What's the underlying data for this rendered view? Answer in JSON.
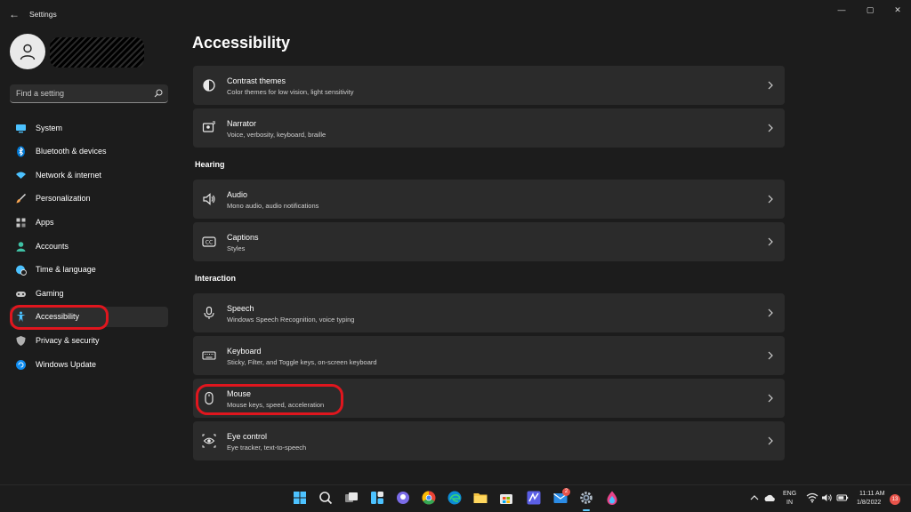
{
  "window": {
    "title": "Settings",
    "back_glyph": "←",
    "controls": {
      "minimize": "—",
      "maximize": "▢",
      "close": "✕"
    }
  },
  "search": {
    "placeholder": "Find a setting",
    "icon": "search-icon"
  },
  "sidebar": {
    "items": [
      {
        "label": "System",
        "icon": "monitor-icon",
        "color": "#4cc2ff"
      },
      {
        "label": "Bluetooth & devices",
        "icon": "bluetooth-icon",
        "color": "#0078d4"
      },
      {
        "label": "Network & internet",
        "icon": "wifi-icon",
        "color": "#4cc2ff"
      },
      {
        "label": "Personalization",
        "icon": "brush-icon",
        "color": "#f7a552"
      },
      {
        "label": "Apps",
        "icon": "apps-icon",
        "color": "#c6c6c6"
      },
      {
        "label": "Accounts",
        "icon": "person-icon",
        "color": "#3fc1a5"
      },
      {
        "label": "Time & language",
        "icon": "globe-clock-icon",
        "color": "#4cc2ff"
      },
      {
        "label": "Gaming",
        "icon": "gamepad-icon",
        "color": "#c6c6c6"
      },
      {
        "label": "Accessibility",
        "icon": "accessibility-icon",
        "color": "#4cc2ff",
        "active": true
      },
      {
        "label": "Privacy & security",
        "icon": "shield-icon",
        "color": "#b0b0b0"
      },
      {
        "label": "Windows Update",
        "icon": "update-icon",
        "color": "#0f8cf0"
      }
    ]
  },
  "main": {
    "title": "Accessibility",
    "groups": [
      {
        "heading": "",
        "cards": [
          {
            "title": "Contrast themes",
            "subtitle": "Color themes for low vision, light sensitivity",
            "icon": "contrast-icon"
          },
          {
            "title": "Narrator",
            "subtitle": "Voice, verbosity, keyboard, braille",
            "icon": "narrator-icon"
          }
        ]
      },
      {
        "heading": "Hearing",
        "cards": [
          {
            "title": "Audio",
            "subtitle": "Mono audio, audio notifications",
            "icon": "speaker-icon"
          },
          {
            "title": "Captions",
            "subtitle": "Styles",
            "icon": "captions-icon"
          }
        ]
      },
      {
        "heading": "Interaction",
        "cards": [
          {
            "title": "Speech",
            "subtitle": "Windows Speech Recognition, voice typing",
            "icon": "microphone-icon"
          },
          {
            "title": "Keyboard",
            "subtitle": "Sticky, Filter, and Toggle keys, on-screen keyboard",
            "icon": "keyboard-icon"
          },
          {
            "title": "Mouse",
            "subtitle": "Mouse keys, speed, acceleration",
            "icon": "mouse-icon"
          },
          {
            "title": "Eye control",
            "subtitle": "Eye tracker, text-to-speech",
            "icon": "eye-icon"
          }
        ]
      }
    ]
  },
  "taskbar": {
    "mail_badge": "2",
    "language": {
      "line1": "ENG",
      "line2": "IN"
    },
    "clock": {
      "time": "11:11 AM",
      "date": "1/8/2022"
    },
    "notification_count": "13"
  },
  "colors": {
    "highlight": "#e0161e",
    "accent": "#60cdff",
    "card_bg": "#2b2b2b",
    "window_bg": "#1c1c1c"
  }
}
